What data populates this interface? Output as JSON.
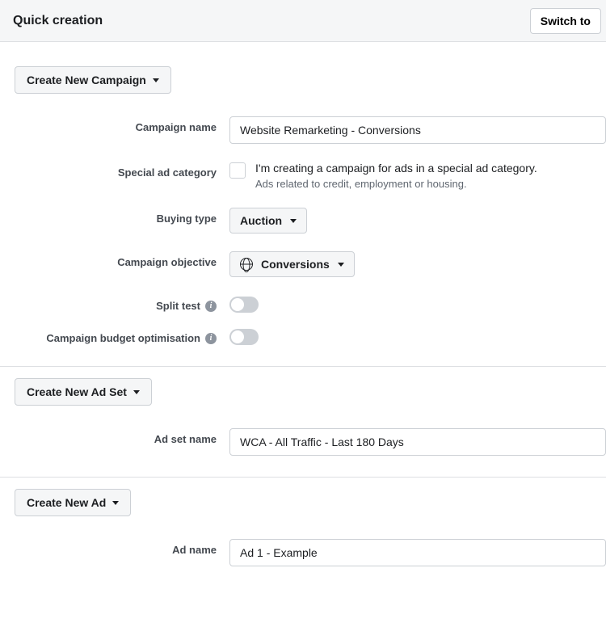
{
  "header": {
    "title": "Quick creation",
    "switch_label": "Switch to"
  },
  "campaign": {
    "dropdown_label": "Create New Campaign",
    "rows": {
      "name_label": "Campaign name",
      "name_value": "Website Remarketing - Conversions",
      "special_label": "Special ad category",
      "special_text": "I'm creating a campaign for ads in a special ad category.",
      "special_hint": "Ads related to credit, employment or housing.",
      "buying_label": "Buying type",
      "buying_value": "Auction",
      "objective_label": "Campaign objective",
      "objective_value": "Conversions",
      "split_label": "Split test",
      "budget_label": "Campaign budget optimisation"
    }
  },
  "adset": {
    "dropdown_label": "Create New Ad Set",
    "name_label": "Ad set name",
    "name_value": "WCA - All Traffic - Last 180 Days"
  },
  "ad": {
    "dropdown_label": "Create New Ad",
    "name_label": "Ad name",
    "name_value": "Ad 1 - Example"
  }
}
